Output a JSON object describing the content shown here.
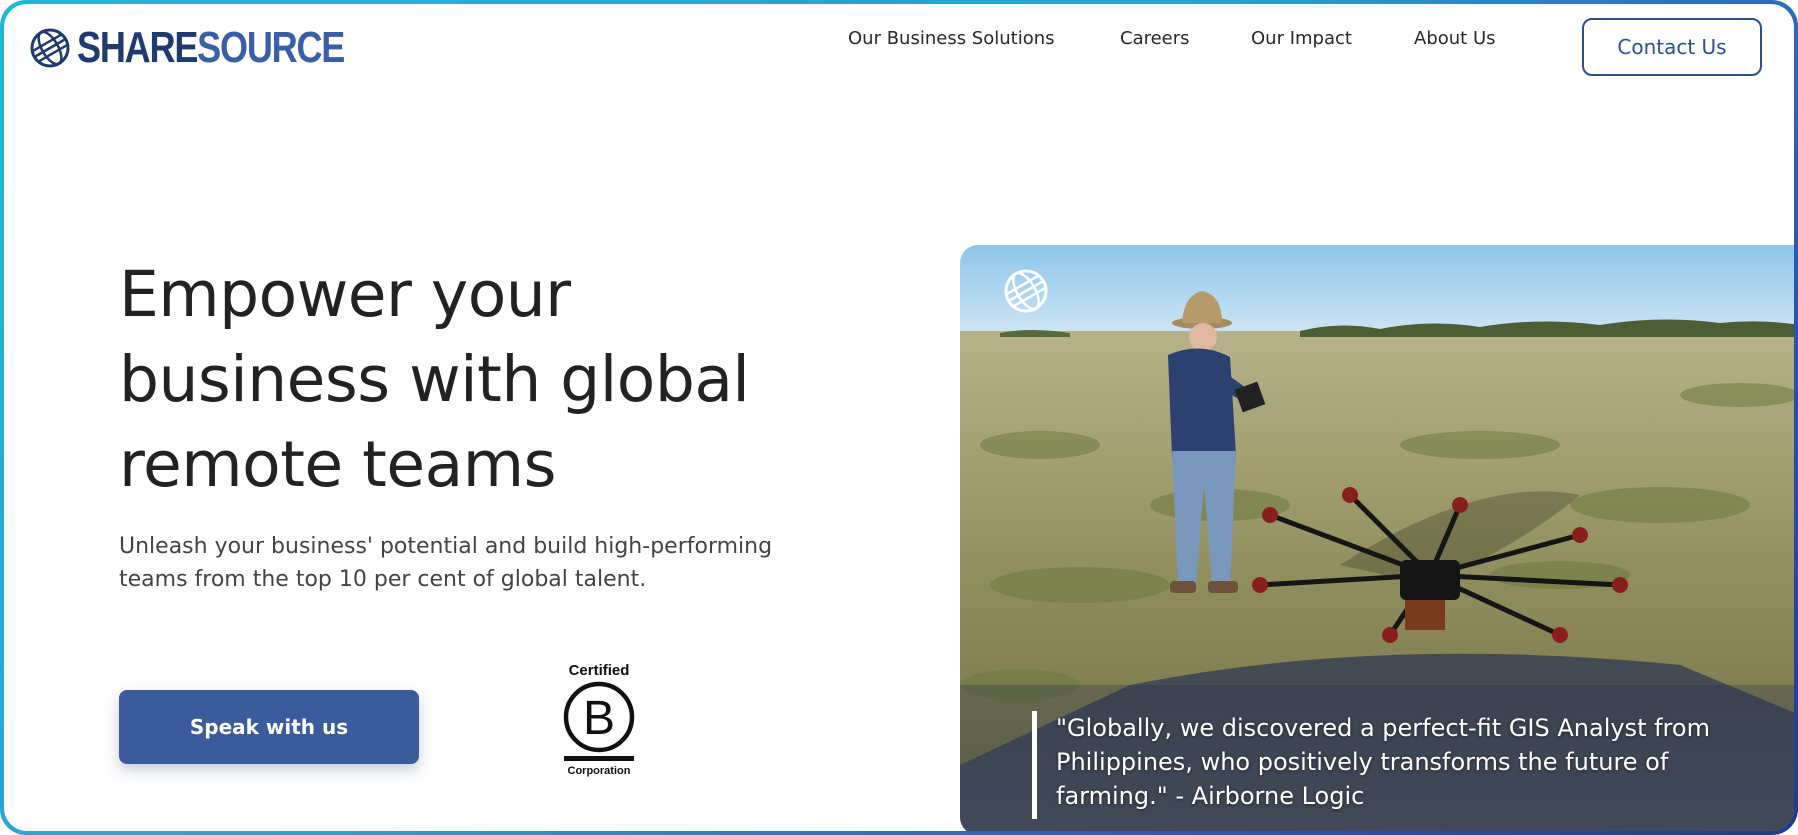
{
  "brand": {
    "part1": "SHARE",
    "part2": "SOURCE",
    "color_dark": "#1f3a6e",
    "color_light": "#3a5fa8"
  },
  "nav": {
    "items": [
      "Our Business Solutions",
      "Careers",
      "Our Impact",
      "About Us"
    ],
    "contact_label": "Contact Us"
  },
  "hero": {
    "headline_line1": "Empower your",
    "headline_line2": "business with global",
    "headline_line3": "remote teams",
    "subhead_line1": "Unleash your business' potential and build high-performing",
    "subhead_line2": "teams from the top 10 per cent of global talent.",
    "cta_label": "Speak with us"
  },
  "bcorp": {
    "top": "Certified",
    "letter": "B",
    "bottom": "Corporation"
  },
  "photo": {
    "quote_line1": "\"Globally, we discovered a perfect-fit GIS Analyst from",
    "quote_line2": "Philippines, who positively transforms the future of",
    "quote_line3": "farming.\" - Airborne Logic"
  },
  "colors": {
    "primary": "#3b5b9c",
    "border_gradient_start": "#1fb8d6",
    "border_gradient_end": "#1e3c8f"
  }
}
